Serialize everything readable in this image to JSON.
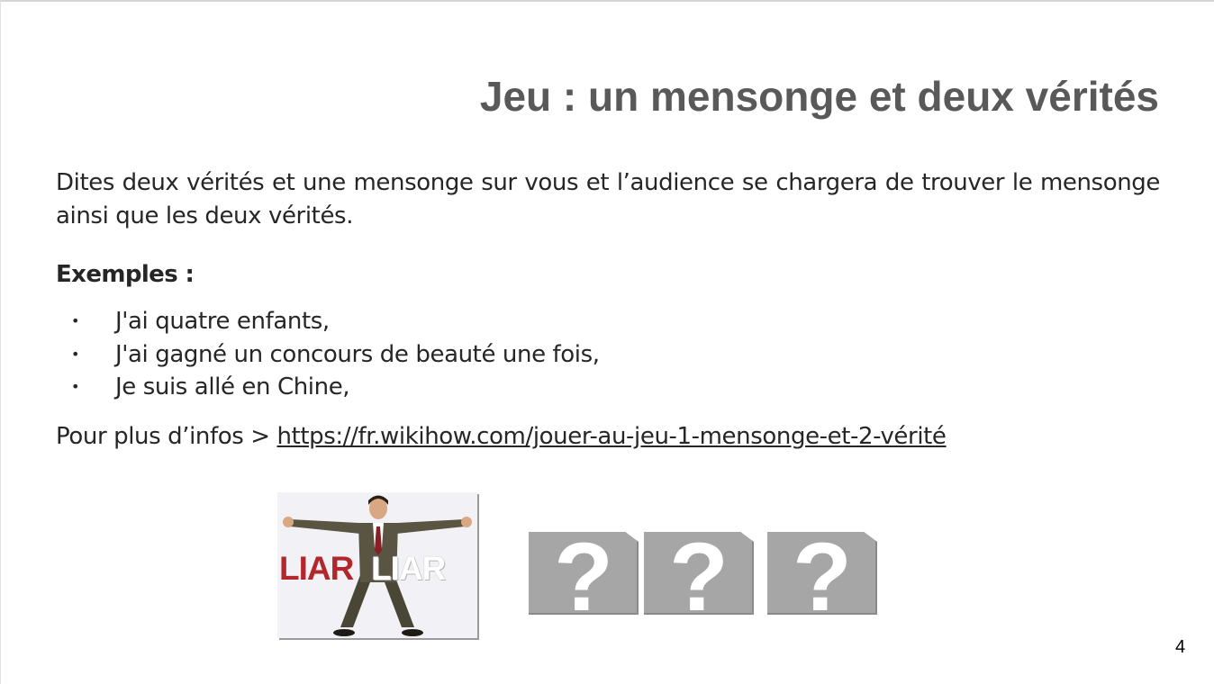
{
  "slide": {
    "title": "Jeu : un mensonge et deux vérités",
    "intro": "Dites deux vérités et une mensonge sur vous et l’audience se chargera de trouver le mensonge ainsi que les deux vérités.",
    "examples_heading": "Exemples :",
    "bullet_char": "•",
    "examples": [
      "J'ai quatre enfants,",
      "J'ai gagné un concours de beauté une fois,",
      "Je suis allé en Chine,"
    ],
    "more_info_prefix": "Pour plus d’infos > ",
    "more_info_link": "https://fr.wikihow.com/jouer-au-jeu-1-mensonge-et-2-vérité",
    "image": {
      "word_red": "LIAR",
      "word_white": "LIAR"
    },
    "question_mark": "?",
    "page_number": "4"
  },
  "colors": {
    "title": "#595959",
    "body_text": "#262626",
    "liar_red": "#b3262b",
    "question_box": "#a6a6a6"
  }
}
